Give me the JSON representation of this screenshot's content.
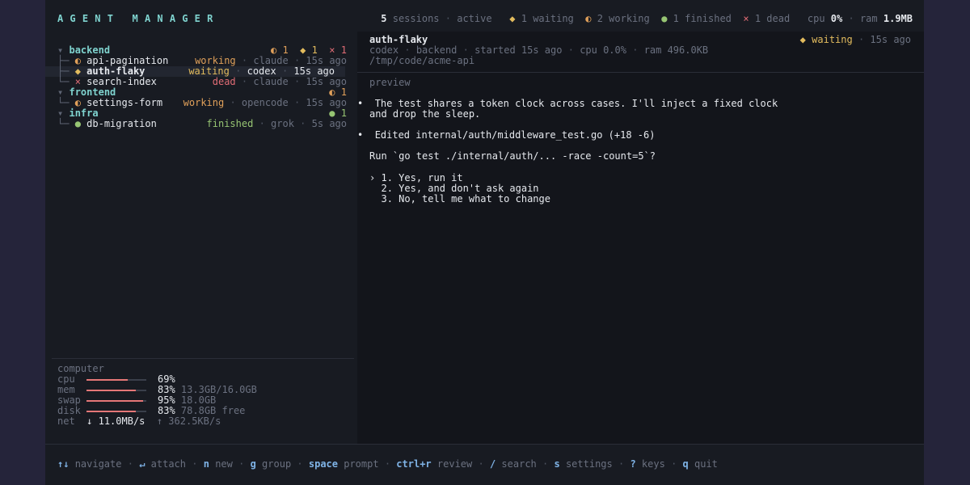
{
  "app": {
    "title": "AGENT MANAGER"
  },
  "topbar": {
    "sessions_count": "5",
    "sessions_label": "sessions",
    "active": "active",
    "waiting_icon": "◆",
    "waiting": "1 waiting",
    "working_icon": "◐",
    "working": "2 working",
    "finished_icon": "●",
    "finished": "1 finished",
    "dead_icon": "×",
    "dead": "1 dead",
    "cpu_label": "cpu",
    "cpu_value": "0%",
    "ram_label": "ram",
    "ram_value": "1.9MB"
  },
  "groups": [
    {
      "caret": "▾",
      "name": "backend",
      "badges": [
        {
          "icon": "◐",
          "count": "1",
          "color": "orange"
        },
        {
          "icon": "◆",
          "count": "1",
          "color": "yellow"
        },
        {
          "icon": "×",
          "count": "1",
          "color": "red"
        }
      ],
      "sessions": [
        {
          "tree": "├─",
          "icon": "◐",
          "icon_color": "orange",
          "name": "api-pagination",
          "status": "working",
          "status_color": "orange",
          "agent": "claude",
          "time": "15s ago",
          "selected": false
        },
        {
          "tree": "├─",
          "icon": "◆",
          "icon_color": "yellow",
          "name": "auth-flaky",
          "status": "waiting",
          "status_color": "yellow",
          "agent": "codex",
          "time": "15s ago",
          "selected": true
        },
        {
          "tree": "└─",
          "icon": "×",
          "icon_color": "red",
          "name": "search-index",
          "status": "dead",
          "status_color": "red",
          "agent": "claude",
          "time": "15s ago",
          "selected": false
        }
      ]
    },
    {
      "caret": "▾",
      "name": "frontend",
      "badges": [
        {
          "icon": "◐",
          "count": "1",
          "color": "orange"
        }
      ],
      "sessions": [
        {
          "tree": "└─",
          "icon": "◐",
          "icon_color": "orange",
          "name": "settings-form",
          "status": "working",
          "status_color": "orange",
          "agent": "opencode",
          "time": "15s ago",
          "selected": false
        }
      ]
    },
    {
      "caret": "▾",
      "name": "infra",
      "badges": [
        {
          "icon": "●",
          "count": "1",
          "color": "green"
        }
      ],
      "sessions": [
        {
          "tree": "└─",
          "icon": "●",
          "icon_color": "green",
          "name": "db-migration",
          "status": "finished",
          "status_color": "green",
          "agent": "grok",
          "time": "5s ago",
          "selected": false
        }
      ]
    }
  ],
  "computer": {
    "title": "computer",
    "metrics": [
      {
        "label": "cpu",
        "percent": "69%",
        "fraction": 0.69,
        "detail": ""
      },
      {
        "label": "mem",
        "percent": "83%",
        "fraction": 0.83,
        "detail": "13.3GB/16.0GB"
      },
      {
        "label": "swap",
        "percent": "95%",
        "fraction": 0.95,
        "detail": "18.0GB"
      },
      {
        "label": "disk",
        "percent": "83%",
        "fraction": 0.83,
        "detail": "78.8GB free"
      }
    ],
    "net_label": "net",
    "net_down": "↓ 11.0MB/s",
    "net_up": "↑ 362.5KB/s"
  },
  "detail": {
    "name": "auth-flaky",
    "status_icon": "◆",
    "status": "waiting",
    "time": "15s ago",
    "agent": "codex",
    "group": "backend",
    "started": "started 15s ago",
    "cpu": "cpu 0.0%",
    "ram": "ram 496.0KB",
    "path": "/tmp/code/acme-api",
    "preview_label": "preview",
    "bullet1_line1": "The test shares a token clock across cases. I'll inject a fixed clock",
    "bullet1_line2": "and drop the sleep.",
    "bullet2": "Edited internal/auth/middleware_test.go (+18 -6)",
    "question": "Run `go test ./internal/auth/... -race -count=5`?",
    "options": [
      {
        "marker": "›",
        "text": "1. Yes, run it"
      },
      {
        "marker": "",
        "text": "2. Yes, and don't ask again"
      },
      {
        "marker": "",
        "text": "3. No, tell me what to change"
      }
    ]
  },
  "footer": {
    "keys": [
      {
        "key": "↑↓",
        "action": "navigate"
      },
      {
        "key": "↵",
        "action": "attach"
      },
      {
        "key": "n",
        "action": "new"
      },
      {
        "key": "g",
        "action": "group"
      },
      {
        "key": "space",
        "action": "prompt"
      },
      {
        "key": "ctrl+r",
        "action": "review"
      },
      {
        "key": "/",
        "action": "search"
      },
      {
        "key": "s",
        "action": "settings"
      },
      {
        "key": "?",
        "action": "keys"
      },
      {
        "key": "q",
        "action": "quit"
      }
    ]
  }
}
